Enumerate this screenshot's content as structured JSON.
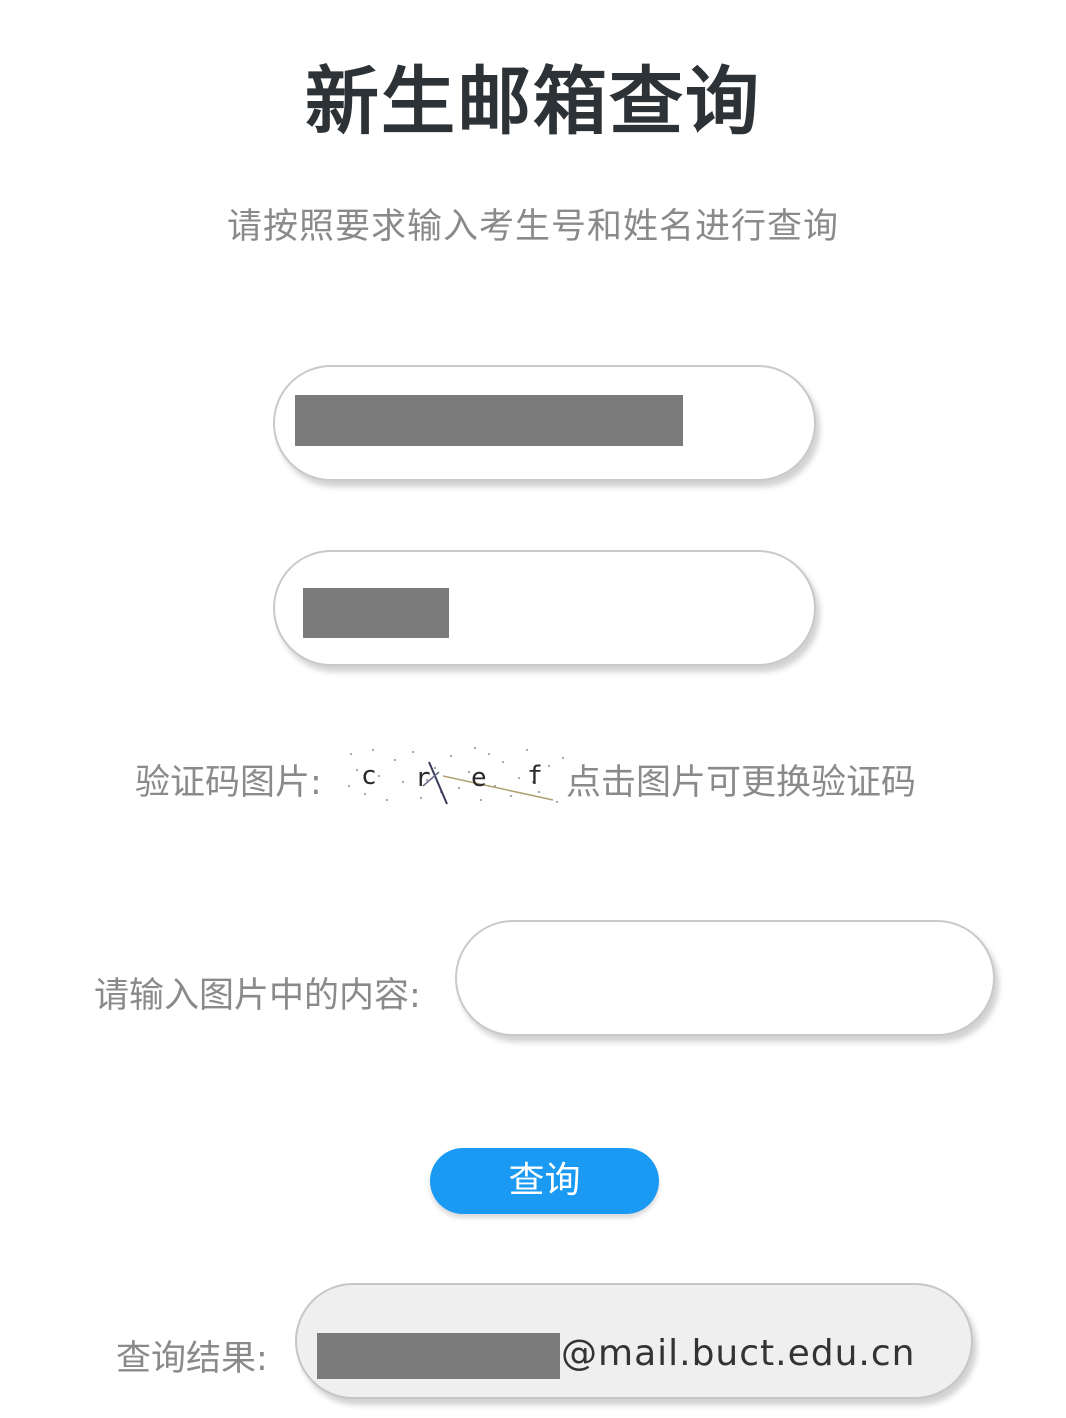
{
  "page": {
    "title": "新生邮箱查询",
    "subtitle": "请按照要求输入考生号和姓名进行查询"
  },
  "form": {
    "exam_number": {
      "value": ""
    },
    "name": {
      "value": ""
    },
    "captcha": {
      "label": "验证码图片:",
      "image_text": "c r e f",
      "hint": "点击图片可更换验证码"
    },
    "code": {
      "label": "请输入图片中的内容:",
      "value": ""
    },
    "submit_label": "查询"
  },
  "result": {
    "label": "查询结果:",
    "email_domain": "@mail.buct.edu.cn"
  },
  "colors": {
    "accent": "#1a9af3",
    "redaction": "#7b7b7b",
    "title": "#2c3235",
    "muted_text": "#8a8a8a"
  }
}
